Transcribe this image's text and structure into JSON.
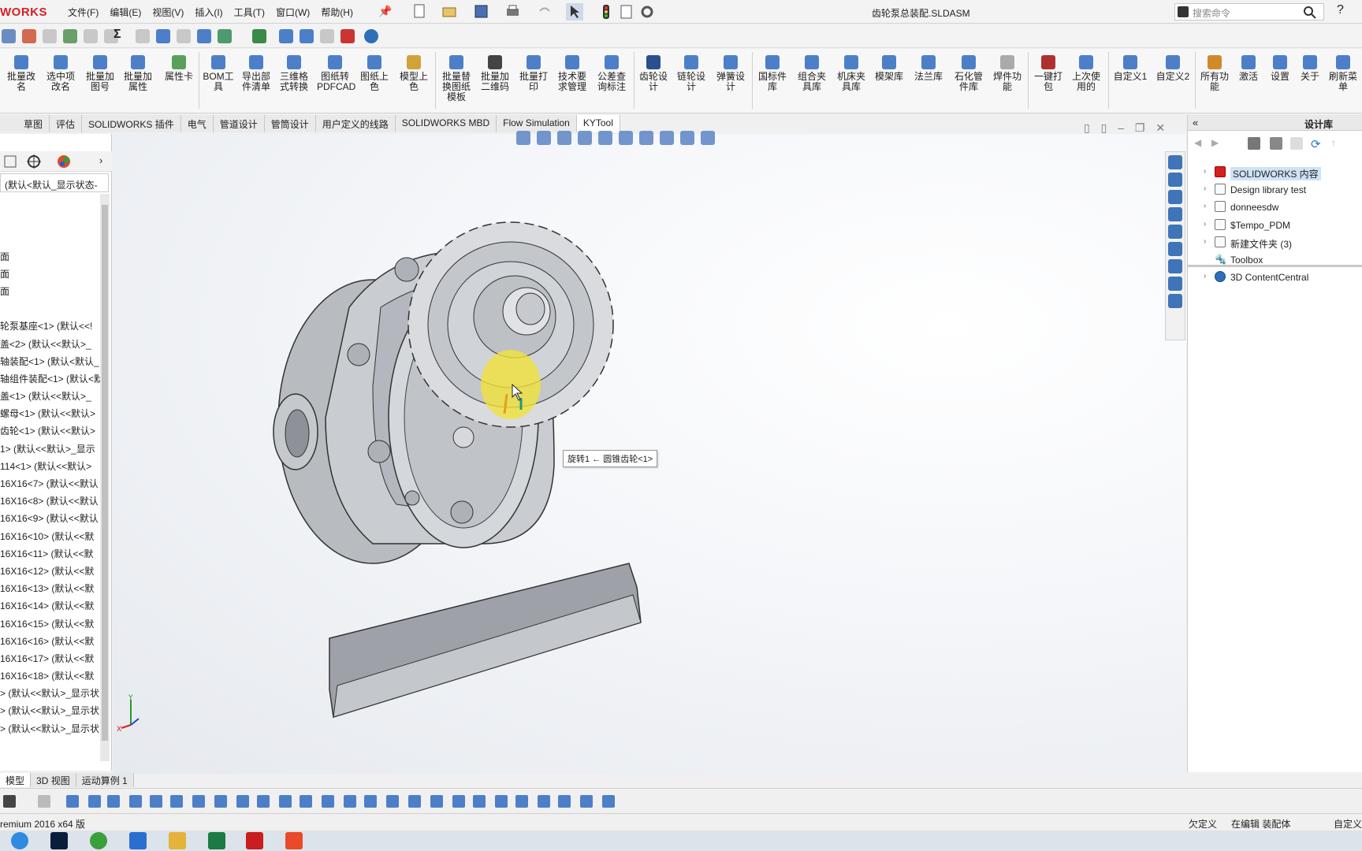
{
  "app": {
    "logo": "WORKS",
    "document_title": "齿轮泵总装配.SLDASM",
    "search_placeholder": "搜索命令",
    "help": "?"
  },
  "menu": [
    "文件(F)",
    "编辑(E)",
    "视图(V)",
    "插入(I)",
    "工具(T)",
    "窗口(W)",
    "帮助(H)"
  ],
  "ribbon": [
    "批量改名",
    "选中项改名",
    "批量加图号",
    "批量加属性",
    "属性卡",
    "BOM工具",
    "导出部件清单",
    "三维格式转换",
    "图纸转PDFCAD",
    "图纸上色",
    "模型上色",
    "批量替换图纸模板",
    "批量加二维码",
    "批量打印",
    "技术要求管理",
    "公差查询标注",
    "齿轮设计",
    "链轮设计",
    "弹簧设计",
    "国标件库",
    "组合夹具库",
    "机床夹具库",
    "模架库",
    "法兰库",
    "石化管件库",
    "焊件功能",
    "一键打包",
    "上次使用的",
    "自定义1",
    "自定义2",
    "所有功能",
    "激活",
    "设置",
    "关于",
    "刷新菜单"
  ],
  "tabs": [
    "草图",
    "评估",
    "SOLIDWORKS 插件",
    "电气",
    "管道设计",
    "管筒设计",
    "用户定义的线路",
    "SOLIDWORKS MBD",
    "Flow Simulation",
    "KYTool"
  ],
  "tree": {
    "header": "(默认<默认_显示状态-",
    "items": [
      "",
      "",
      "",
      "面",
      "面",
      "面",
      "",
      "轮泵基座<1> (默认<<!",
      "盖<2> (默认<<默认>_",
      "轴装配<1> (默认<默认_",
      "轴组件装配<1> (默认<默",
      "盖<1> (默认<<默认>_",
      "螺母<1> (默认<<默认>",
      "齿轮<1> (默认<<默认>",
      "1> (默认<<默认>_显示",
      "114<1> (默认<<默认>",
      "16X16<7> (默认<<默认",
      "16X16<8> (默认<<默认",
      "16X16<9> (默认<<默认",
      "16X16<10> (默认<<默",
      "16X16<11> (默认<<默",
      "16X16<12> (默认<<默",
      "16X16<13> (默认<<默",
      "16X16<14> (默认<<默",
      "16X16<15> (默认<<默",
      "16X16<16> (默认<<默",
      "16X16<17> (默认<<默",
      "16X16<18> (默认<<默",
      "> (默认<<默认>_显示状",
      "> (默认<<默认>_显示状",
      "> (默认<<默认>_显示状"
    ]
  },
  "viewport": {
    "tooltip": "旋转1 ← 圆锥齿轮<1>"
  },
  "design_library": {
    "title": "设计库",
    "items": [
      {
        "label": "SOLIDWORKS 内容",
        "expandable": true
      },
      {
        "label": "Design library test",
        "expandable": true
      },
      {
        "label": "donneesdw",
        "expandable": true
      },
      {
        "label": "$Tempo_PDM",
        "expandable": true
      },
      {
        "label": "新建文件夹 (3)",
        "expandable": true
      },
      {
        "label": "Toolbox",
        "expandable": false
      },
      {
        "label": "3D ContentCentral",
        "expandable": true
      }
    ]
  },
  "bottom_tabs": [
    "模型",
    "3D 视图",
    "运动算例 1"
  ],
  "status": {
    "version": "remium 2016 x64 版",
    "undefined": "欠定义",
    "editing": "在编辑 装配体",
    "custom": "自定义"
  }
}
